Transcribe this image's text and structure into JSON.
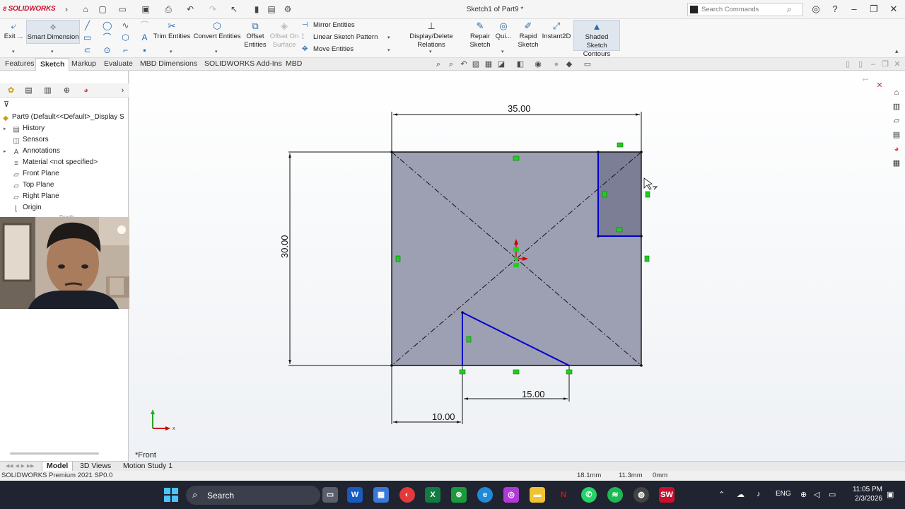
{
  "app": {
    "name": "SOLIDWORKS",
    "doc_title": "Sketch1 of Part9 *",
    "search_placeholder": "Search Commands"
  },
  "ribbon": {
    "exit": "Exit ...",
    "smart_dimension": "Smart Dimension",
    "trim": "Trim Entities",
    "convert": "Convert Entities",
    "offset_line1": "Offset",
    "offset_line2": "Entities",
    "offset_surface_line1": "Offset On",
    "offset_surface_line2": "Surface",
    "mirror": "Mirror Entities",
    "linear_pattern": "Linear Sketch Pattern",
    "move": "Move Entities",
    "display_delete": "Display/Delete Relations",
    "repair_line1": "Repair",
    "repair_line2": "Sketch",
    "quick": "Qui...",
    "rapid_line1": "Rapid",
    "rapid_line2": "Sketch",
    "instant2d": "Instant2D",
    "shaded_line1": "Shaded Sketch",
    "shaded_line2": "Contours"
  },
  "tabs": [
    "Features",
    "Sketch",
    "Markup",
    "Evaluate",
    "MBD Dimensions",
    "SOLIDWORKS Add-Ins",
    "MBD"
  ],
  "active_tab": "Sketch",
  "tree": {
    "root": "Part9  (Default<<Default>_Display S",
    "items": [
      "History",
      "Sensors",
      "Annotations",
      "Material <not specified>",
      "Front Plane",
      "Top Plane",
      "Right Plane",
      "Origin"
    ],
    "hidden_tooltip": "Depth"
  },
  "sketch": {
    "dim_width": "35.00",
    "dim_height": "30.00",
    "dim_slot": "15.00",
    "dim_offset": "10.00"
  },
  "view_name": "*Front",
  "bottom_tabs": [
    "Model",
    "3D Views",
    "Motion Study 1"
  ],
  "status": {
    "product": "SOLIDWORKS Premium 2021 SP0.0",
    "x": "18.1mm",
    "y": "11.3mm",
    "z": "0mm"
  },
  "taskbar": {
    "search": "Search",
    "lang": "ENG",
    "time": "11:05 PM",
    "date": "2/3/2026"
  },
  "colors": {
    "sketch_fill": "#9d9fb2",
    "sketch_line": "#0000cc",
    "relation_marker": "#22cc22",
    "brand_red": "#c8102e"
  }
}
